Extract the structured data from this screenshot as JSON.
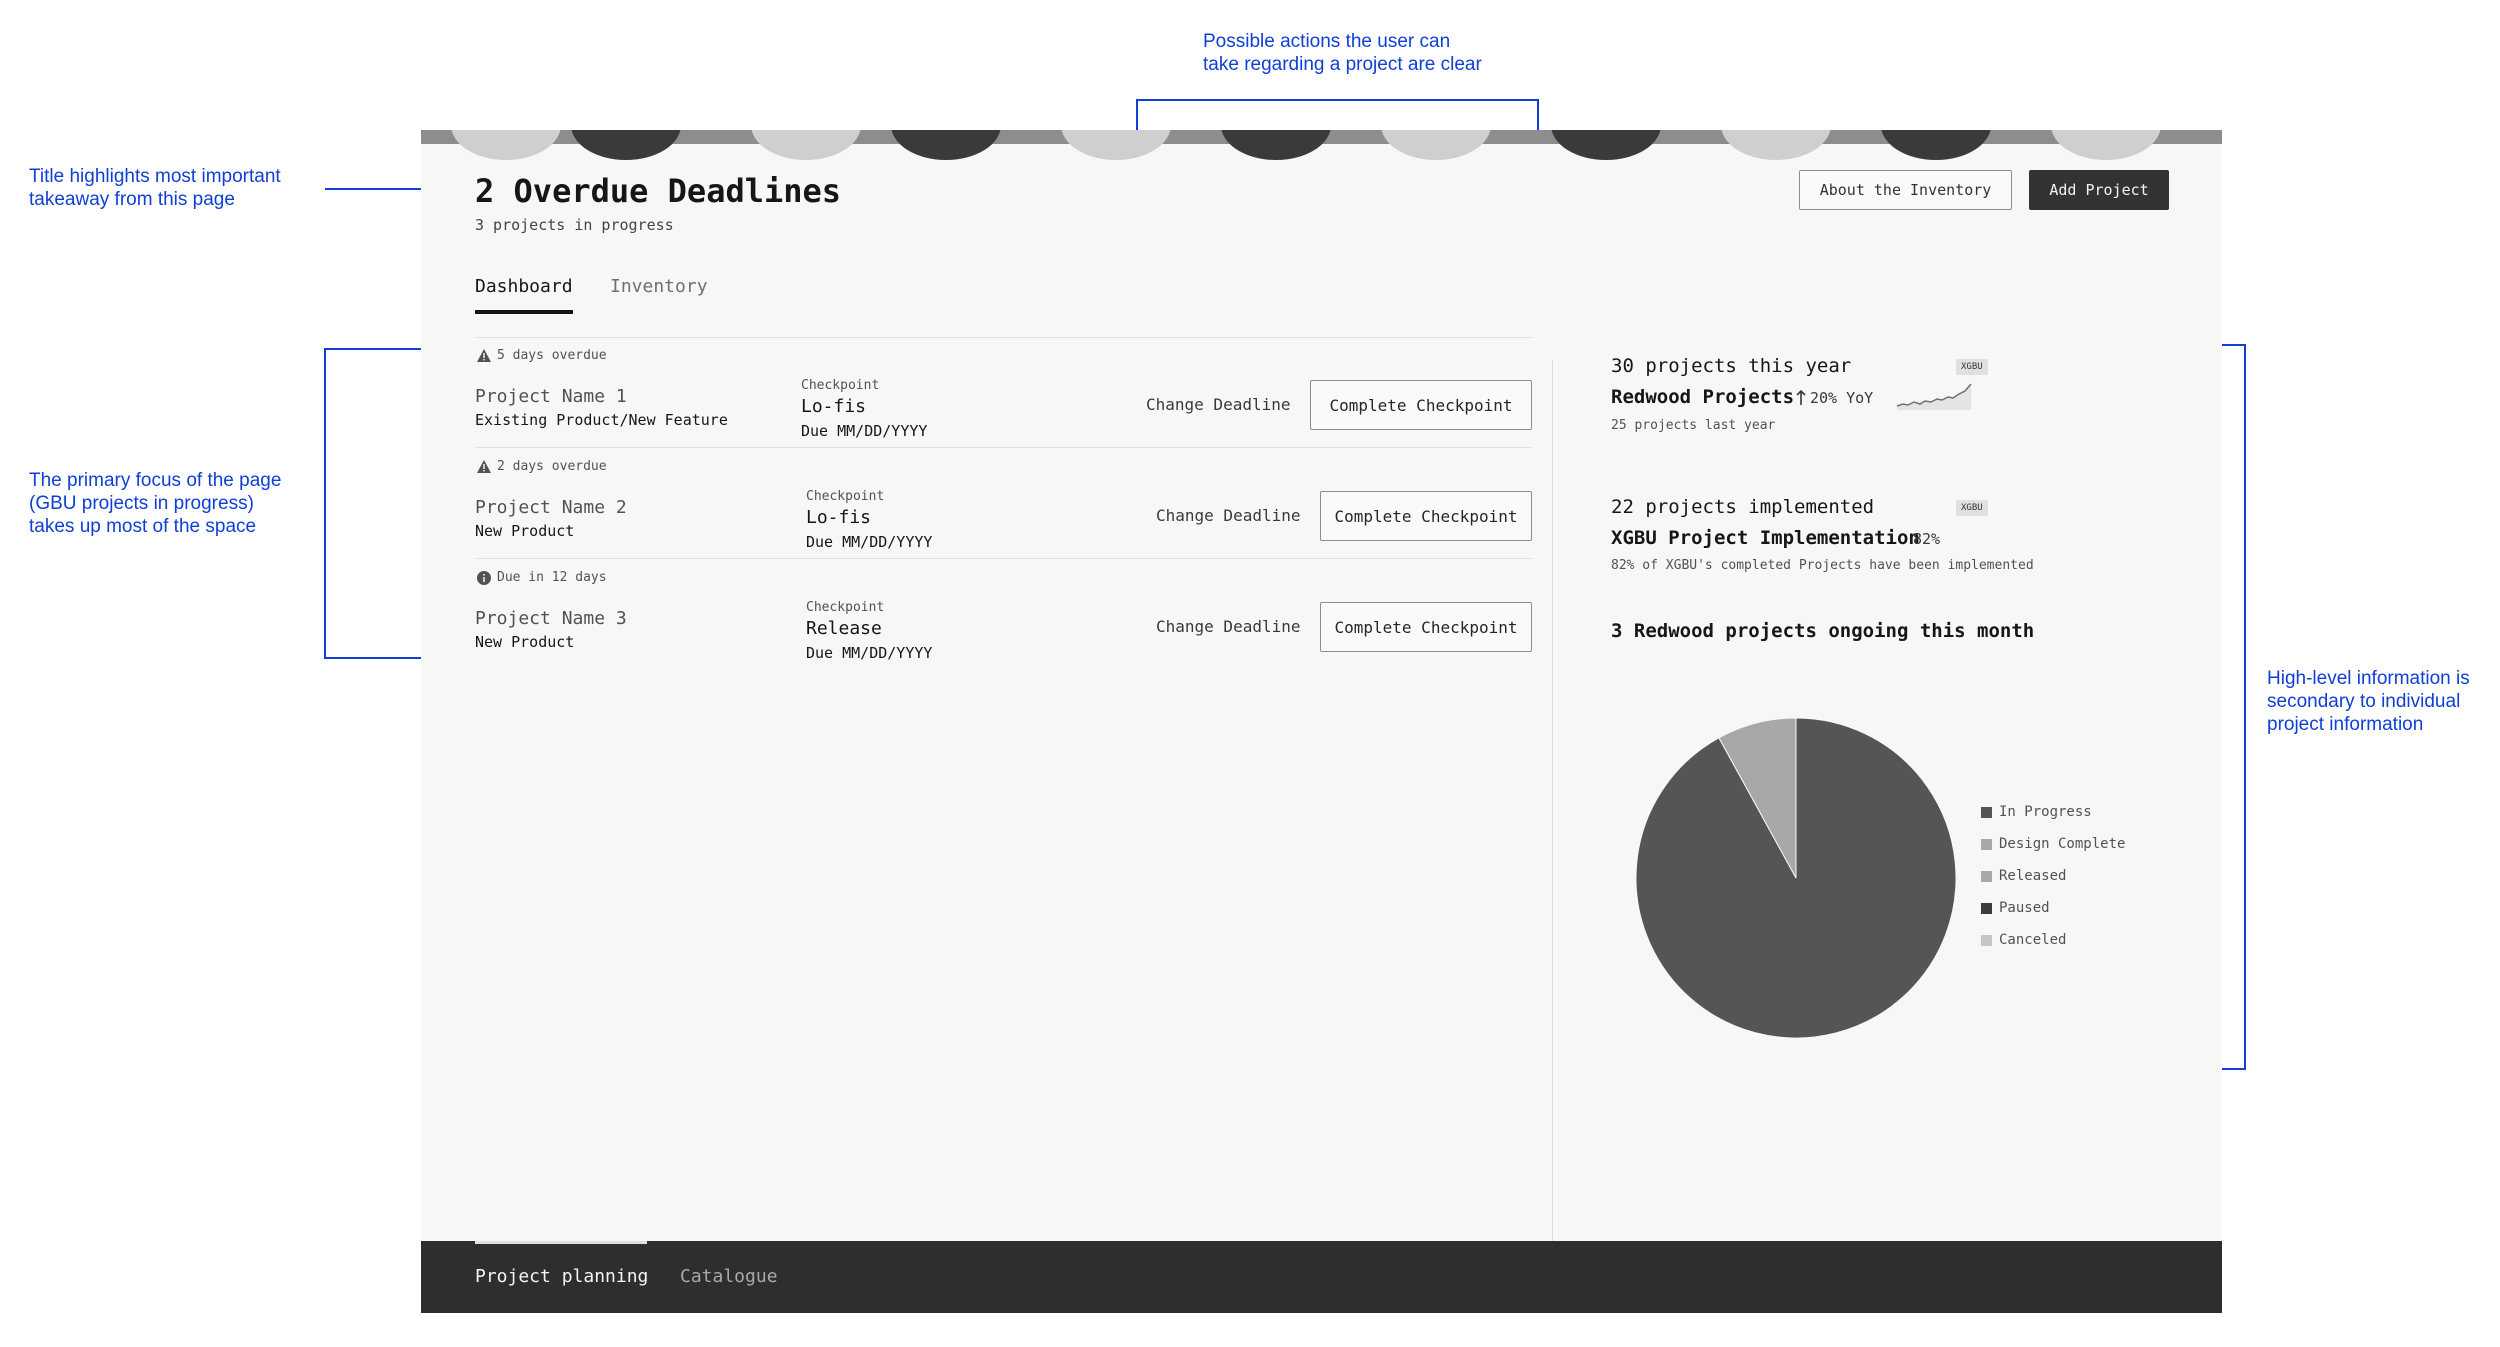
{
  "annotations": {
    "actions_note": [
      "Possible actions the user can",
      "take regarding a project are clear"
    ],
    "title_note": [
      "Title highlights most important",
      "takeaway from this page"
    ],
    "focus_note": [
      "The primary focus of the page",
      "(GBU projects in progress)",
      "takes up most of the space"
    ],
    "highlevel_note": [
      "High-level information is",
      "secondary to individual",
      "project information"
    ]
  },
  "header": {
    "title": "2 Overdue Deadlines",
    "subtitle": "3 projects in progress",
    "about_button": "About the Inventory",
    "add_button": "Add Project"
  },
  "tabs": [
    {
      "label": "Dashboard",
      "active": true
    },
    {
      "label": "Inventory",
      "active": false
    }
  ],
  "projects": [
    {
      "status_icon": "warning-icon",
      "status": "5 days overdue",
      "name": "Project Name 1",
      "type": "Existing Product/New Feature",
      "checkpoint_label": "Checkpoint",
      "checkpoint": "Lo-fis",
      "due": "Due MM/DD/YYYY",
      "change_label": "Change Deadline",
      "complete_label": "Complete Checkpoint"
    },
    {
      "status_icon": "warning-icon",
      "status": "2 days overdue",
      "name": "Project Name 2",
      "type": "New Product",
      "checkpoint_label": "Checkpoint",
      "checkpoint": "Lo-fis",
      "due": "Due MM/DD/YYYY",
      "change_label": "Change Deadline",
      "complete_label": "Complete Checkpoint"
    },
    {
      "status_icon": "info-icon",
      "status": "Due in 12 days",
      "name": "Project Name 3",
      "type": "New Product",
      "checkpoint_label": "Checkpoint",
      "checkpoint": "Release",
      "due": "Due MM/DD/YYYY",
      "change_label": "Change Deadline",
      "complete_label": "Complete Checkpoint"
    }
  ],
  "stats": {
    "year": {
      "heading": "30 projects this year",
      "tag": "XGBU",
      "title": "Redwood Projects",
      "change": "20% YoY",
      "sub": "25 projects last year",
      "trend_icon": "arrow-up-icon"
    },
    "impl": {
      "heading": "22 projects implemented",
      "tag": "XGBU",
      "title": "XGBU Project Implementation",
      "percent": "82%",
      "sub": "82% of XGBU's completed Projects have been implemented"
    },
    "ongoing": {
      "heading": "3 Redwood projects ongoing this month"
    }
  },
  "colors": {
    "in_progress": "#555555",
    "design_complete": "#a8a8a8",
    "released": "#a8a8a8",
    "paused": "#3d3d3d",
    "canceled": "#c6c6c6"
  },
  "chart_data": {
    "type": "pie",
    "categories": [
      "In Progress",
      "Design Complete",
      "Released",
      "Paused",
      "Canceled"
    ],
    "values": [
      92,
      8,
      0,
      0,
      0
    ],
    "legend": "right"
  },
  "footer": {
    "tabs": [
      {
        "label": "Project planning",
        "active": true
      },
      {
        "label": "Catalogue",
        "active": false
      }
    ]
  }
}
